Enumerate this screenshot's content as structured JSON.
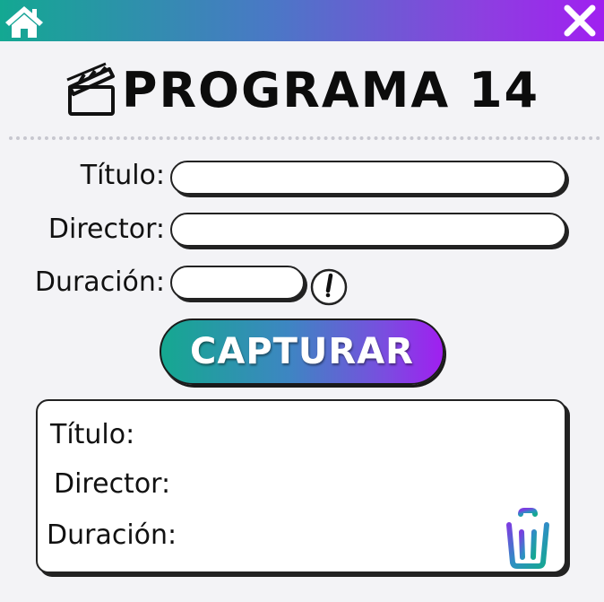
{
  "header": {
    "home_icon": "home-icon",
    "close_icon": "close-icon",
    "gradient_start": "#13a892",
    "gradient_end": "#a020f0"
  },
  "title": {
    "icon": "clapperboard-icon",
    "text": "PROGRAMA 14"
  },
  "form": {
    "titulo_label": "Título:",
    "titulo_value": "",
    "director_label": "Director:",
    "director_value": "",
    "duracion_label": "Duración:",
    "duracion_value": "",
    "duracion_icon": "clock-icon",
    "submit_label": "CAPTURAR"
  },
  "result": {
    "titulo_label": "Título:",
    "director_label": "Director:",
    "duracion_label": "Duración:",
    "delete_icon": "trash-icon"
  }
}
